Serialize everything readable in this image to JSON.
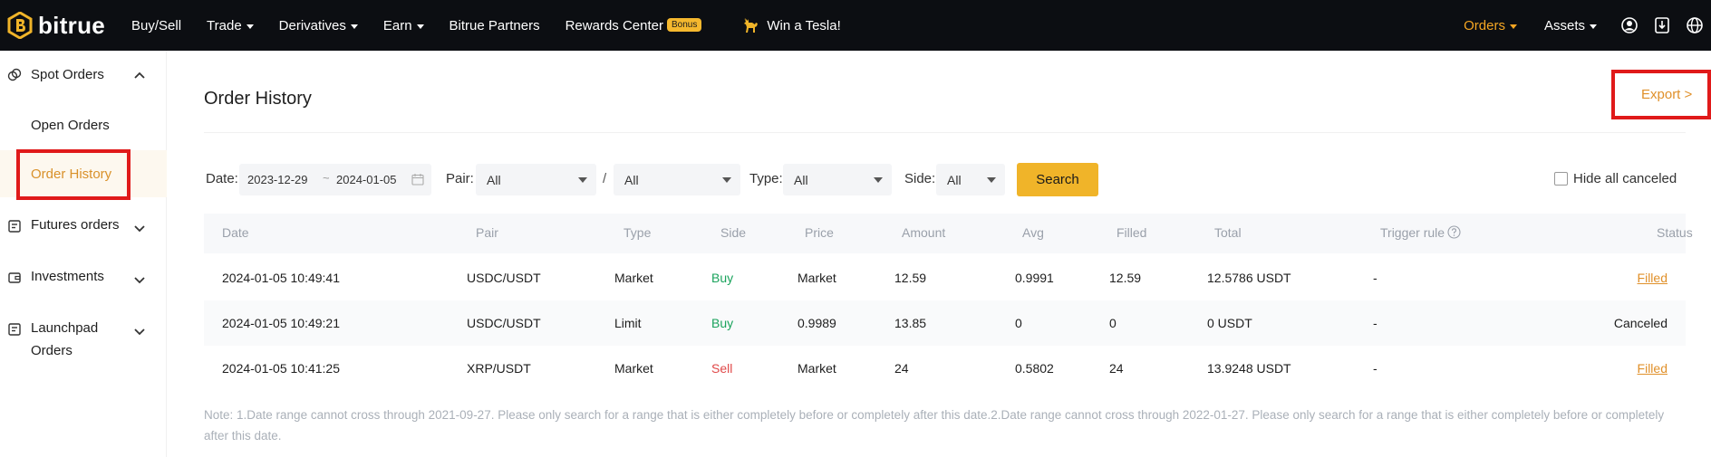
{
  "brand": {
    "name": "bitrue"
  },
  "topnav": {
    "items": [
      {
        "label": "Buy/Sell",
        "caret": false
      },
      {
        "label": "Trade",
        "caret": true
      },
      {
        "label": "Derivatives",
        "caret": true
      },
      {
        "label": "Earn",
        "caret": true
      },
      {
        "label": "Bitrue Partners",
        "caret": false
      },
      {
        "label": "Rewards Center",
        "caret": false
      }
    ],
    "bonus_badge": "Bonus",
    "tesla_label": "Win a Tesla!",
    "orders_label": "Orders",
    "assets_label": "Assets",
    "icons": [
      "user-icon",
      "download-icon",
      "globe-icon"
    ]
  },
  "sidebar": {
    "spot_orders": "Spot Orders",
    "open_orders": "Open Orders",
    "order_history": "Order History",
    "futures_orders": "Futures orders",
    "investments": "Investments",
    "launchpad_line1": "Launchpad",
    "launchpad_line2": "Orders"
  },
  "main": {
    "title": "Order History",
    "export_label": "Export >",
    "filters": {
      "date_label": "Date:",
      "date_from": "2023-12-29",
      "date_sep": "~",
      "date_to": "2024-01-05",
      "pair_label": "Pair:",
      "pair_base": "All",
      "pair_slash": "/",
      "pair_quote": "All",
      "type_label": "Type:",
      "type_value": "All",
      "side_label": "Side:",
      "side_value": "All",
      "search_label": "Search",
      "hide_canceled_label": "Hide all canceled"
    },
    "table": {
      "headers": {
        "date": "Date",
        "pair": "Pair",
        "type": "Type",
        "side": "Side",
        "price": "Price",
        "amount": "Amount",
        "avg": "Avg",
        "filled": "Filled",
        "total": "Total",
        "trigger": "Trigger rule",
        "status": "Status"
      },
      "rows": [
        {
          "date": "2024-01-05 10:49:41",
          "pair": "USDC/USDT",
          "type": "Market",
          "side": "Buy",
          "price": "Market",
          "amount": "12.59",
          "avg": "0.9991",
          "filled": "12.59",
          "total": "12.5786 USDT",
          "trigger": "-",
          "status": "Filled"
        },
        {
          "date": "2024-01-05 10:49:21",
          "pair": "USDC/USDT",
          "type": "Limit",
          "side": "Buy",
          "price": "0.9989",
          "amount": "13.85",
          "avg": "0",
          "filled": "0",
          "total": "0 USDT",
          "trigger": "-",
          "status": "Canceled"
        },
        {
          "date": "2024-01-05 10:41:25",
          "pair": "XRP/USDT",
          "type": "Market",
          "side": "Sell",
          "price": "Market",
          "amount": "24",
          "avg": "0.5802",
          "filled": "24",
          "total": "13.9248 USDT",
          "trigger": "-",
          "status": "Filled"
        }
      ]
    },
    "note": "Note: 1.Date range cannot cross through 2021-09-27. Please only search for a range that is either completely before or completely after this date.2.Date range cannot cross through 2022-01-27. Please only search for a range that is either completely before or completely after this date."
  },
  "colors": {
    "accent": "#f0b429",
    "link": "#e0902a",
    "buy": "#1aa35c",
    "sell": "#e04848",
    "annotation": "#e01a1a"
  }
}
